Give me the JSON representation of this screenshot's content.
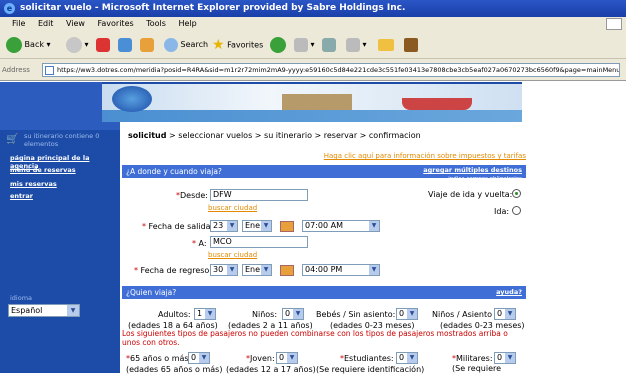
{
  "window": {
    "title": "solicitar vuelo - Microsoft Internet Explorer provided by Sabre Holdings Inc."
  },
  "menu": [
    "File",
    "Edit",
    "View",
    "Favorites",
    "Tools",
    "Help"
  ],
  "toolbar": {
    "back": "Back",
    "search": "Search",
    "favorites": "Favorites"
  },
  "address": {
    "label": "Address",
    "url": "https://ww3.dotres.com/meridia?posid=R4RA&sid=m1r2r72mim2mA9-yyyy:e59160c5d84e221cde3c551fe03413e7808cbe3cb5eaf027a0670273bc6560f9&page=mainMenuMessage_n"
  },
  "nav": {
    "cart_note": "su itinerario contiene 0 elementos",
    "links": [
      "página principal de la agencia",
      "menú de reservas",
      "mis reservas",
      "entrar"
    ],
    "language_label": "idioma",
    "language_value": "Español"
  },
  "breadcrumb": {
    "current": "solicitud",
    "rest": " > seleccionar vuelos > su itinerario > reservar > confirmacion"
  },
  "tax_link": "Haga clic aquí para información sobre impuestos y tarifas",
  "where": {
    "header": "¿A donde y cuando viaja?",
    "add_destinations": "agregar múltiples destinos",
    "required_note": "indica campos obligatorios",
    "from_label": "Desde:",
    "from_value": "DFW",
    "search_city": "buscar ciudad",
    "depart_label": "Fecha de salida:",
    "depart_day": "23",
    "depart_month": "Ene",
    "depart_time": "07:00 AM",
    "to_label": "A:",
    "to_value": "MCO",
    "return_label": "Fecha de regreso:",
    "return_day": "30",
    "return_month": "Ene",
    "return_time": "04:00 PM",
    "roundtrip_label": "Viaje de ida y vuelta:",
    "oneway_label": "Ida:"
  },
  "who": {
    "header": "¿Quien viaja?",
    "help": "ayuda?",
    "adults_label": "Adultos:",
    "adults_value": "1",
    "adults_note": "(edades 18 a 64 años)",
    "children_label": "Niños:",
    "children_value": "0",
    "children_note": "(edades 2 a 11 años)",
    "infants_seat_label": "Bebés / Sin asiento:",
    "infants_seat_value": "0",
    "infants_seat_note": "(edades 0-23 meses)",
    "infants_lap_label": "Niños / Asiento",
    "infants_lap_value": "0",
    "infants_lap_note": "(edades 0-23 meses)",
    "warning": "Los siguientes tipos de pasajeros no pueden combinarse con los tipos de pasajeros mostrados arriba o unos con otros.",
    "senior_label": "65 años o más:",
    "senior_value": "0",
    "senior_note": "(edades 65 años o más)",
    "youth_label": "Joven:",
    "youth_value": "0",
    "youth_note": "(edades 12 a 17 años)",
    "students_label": "Estudiantes:",
    "students_value": "0",
    "students_note": "(Se requiere identificación)",
    "military_label": "Militares:",
    "military_value": "0",
    "military_note": "(Se requiere"
  }
}
